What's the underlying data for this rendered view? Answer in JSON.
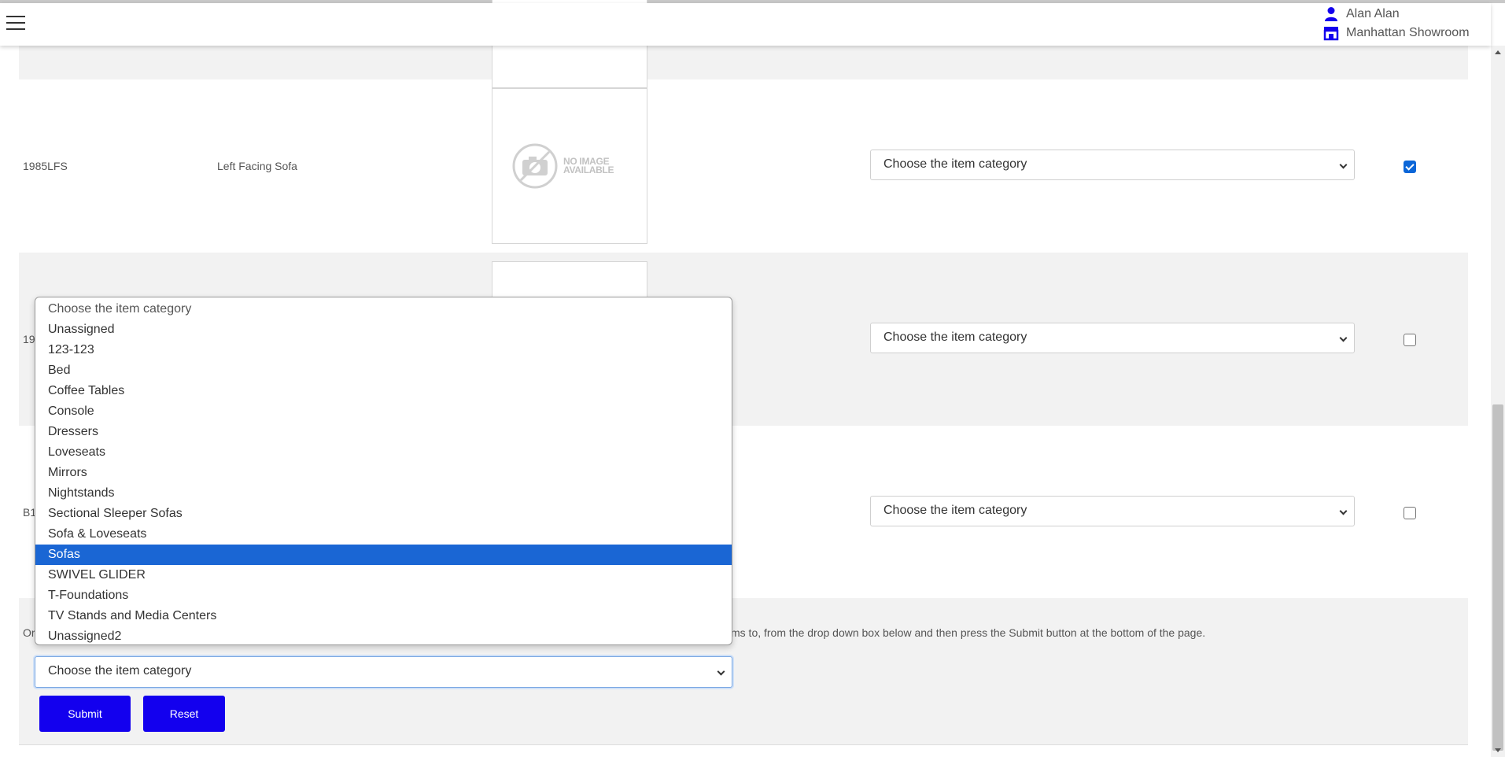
{
  "header": {
    "user_name": "Alan Alan",
    "location": "Manhattan Showroom"
  },
  "rows": [
    {
      "sku": "1985LFS",
      "name": "Left Facing Sofa",
      "image_text": [
        "NO IMAGE",
        "AVAILABLE"
      ],
      "category": "Choose the item category",
      "checked": true
    },
    {
      "sku": "19",
      "category": "Choose the item category",
      "checked": false
    },
    {
      "sku": "B1",
      "category": "Choose the item category",
      "checked": false
    }
  ],
  "bulk": {
    "instruction_left": "Or",
    "instruction_right": "ms to, from the drop down box below and then press the Submit button at the bottom of the page.",
    "selected": "Choose the item category",
    "submit_label": "Submit",
    "reset_label": "Reset"
  },
  "dropdown": {
    "options": [
      "Choose the item category",
      "Unassigned",
      "123-123",
      "Bed",
      "Coffee Tables",
      "Console",
      "Dressers",
      "Loveseats",
      "Mirrors",
      "Nightstands",
      "Sectional Sleeper Sofas",
      "Sofa & Loveseats",
      "Sofas",
      "SWIVEL GLIDER",
      "T-Foundations",
      "TV Stands and Media Centers",
      "Unassigned2"
    ],
    "highlighted": "Sofas"
  },
  "colors": {
    "accent_blue": "#1300ee",
    "highlight": "#1a66d4",
    "row_gray": "#f2f2f2"
  }
}
